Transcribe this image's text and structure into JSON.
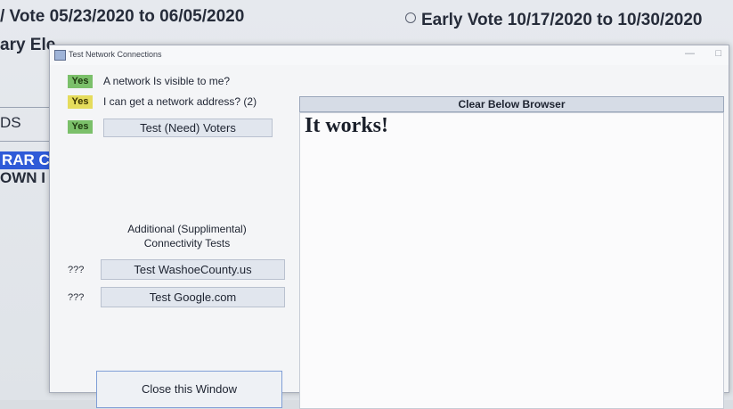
{
  "background": {
    "line1": "/ Vote 05/23/2020 to 06/05/2020",
    "line2": "ary Ele",
    "line3": "Early Vote 10/17/2020 to 10/30/2020",
    "line4": "DS",
    "line5": "RAR C",
    "line6": "OWN I"
  },
  "window": {
    "title": "Test Network Connections",
    "minimize": "—",
    "maximize": "□"
  },
  "tests": [
    {
      "status": "Yes",
      "label": "A network Is visible to me?"
    },
    {
      "status": "Yes",
      "label": "I can get a network address? (2)"
    },
    {
      "status": "Yes",
      "label": "Test (Need) Voters"
    }
  ],
  "supplemental": {
    "heading_line1": "Additional (Supplimental)",
    "heading_line2": "Connectivity Tests",
    "items": [
      {
        "status": "???",
        "label": "Test   WashoeCounty.us"
      },
      {
        "status": "???",
        "label": "Test   Google.com"
      }
    ]
  },
  "close_label": "Close this Window",
  "browser": {
    "clear_label": "Clear Below Browser",
    "content": "It works!"
  },
  "colors": {
    "status_green": "#7bc06a",
    "status_yellow": "#e5dc5c",
    "accent": "#2f5bd8"
  }
}
